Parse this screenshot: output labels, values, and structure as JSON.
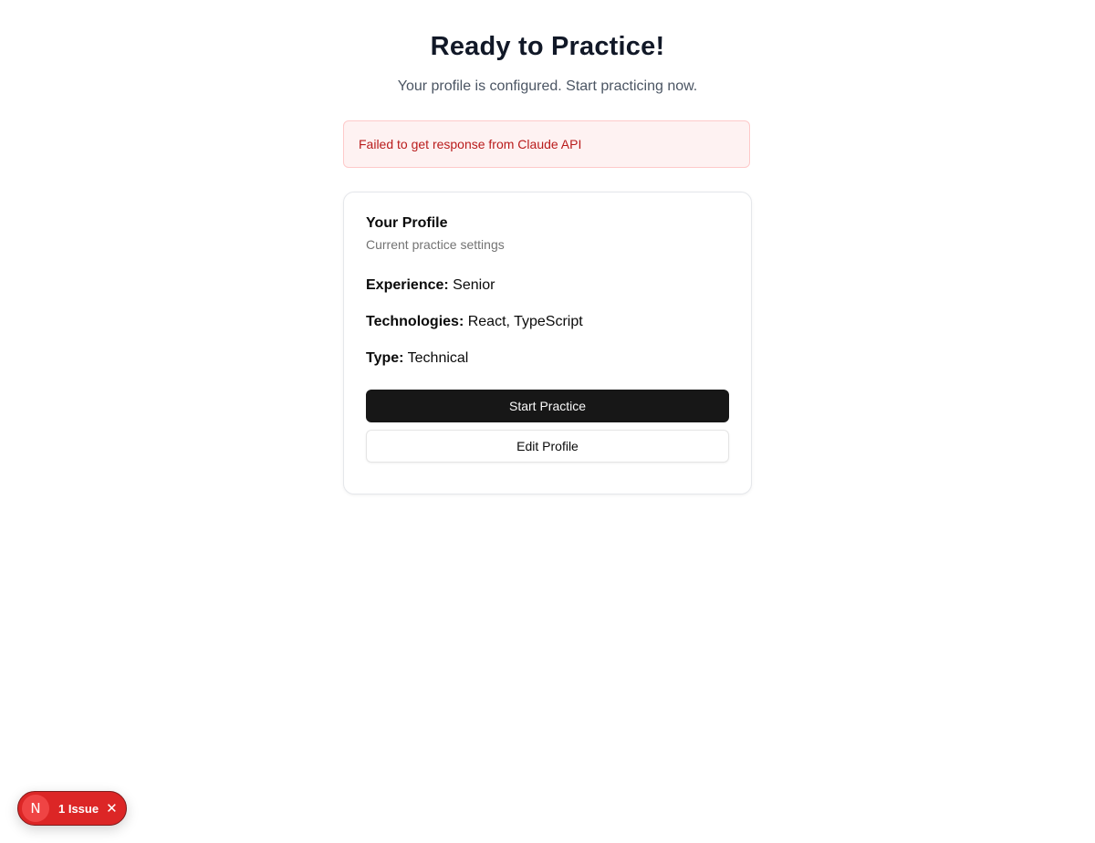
{
  "header": {
    "title": "Ready to Practice!",
    "subtitle": "Your profile is configured. Start practicing now."
  },
  "alert": {
    "message": "Failed to get response from Claude API",
    "color": "#b91c1c",
    "background": "#fef2f2"
  },
  "profile_card": {
    "title": "Your Profile",
    "description": "Current practice settings",
    "fields": [
      {
        "label": "Experience:",
        "value": "Senior"
      },
      {
        "label": "Technologies:",
        "value": "React, TypeScript"
      },
      {
        "label": "Type:",
        "value": "Technical"
      }
    ],
    "start_button_label": "Start Practice",
    "edit_button_label": "Edit Profile"
  },
  "dev_indicator": {
    "logo_letter": "N",
    "issue_label": "1 Issue",
    "close_glyph": "✕",
    "color": "#dc2626"
  }
}
